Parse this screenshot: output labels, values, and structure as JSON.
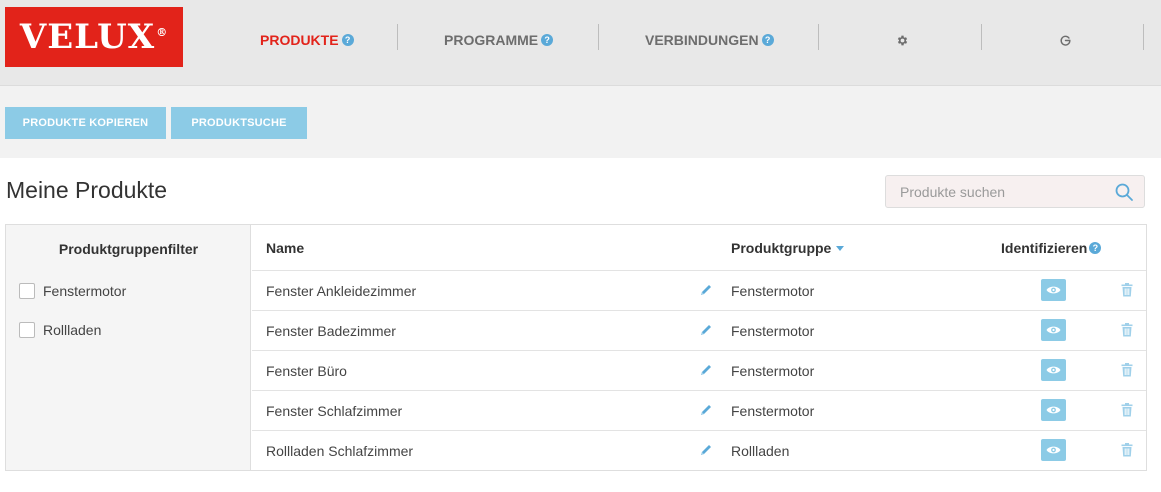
{
  "brand": {
    "logo_text": "VELUX",
    "logo_mark": "®",
    "color": "#e2231a"
  },
  "nav": {
    "items": [
      {
        "label": "PRODUKTE",
        "active": true
      },
      {
        "label": "PROGRAMME",
        "active": false
      },
      {
        "label": "VERBINDUNGEN",
        "active": false
      }
    ],
    "help_glyph": "?",
    "icons": [
      "gear-icon",
      "logout-icon"
    ]
  },
  "toolbar": {
    "copy_label": "PRODUKTE KOPIEREN",
    "search_label": "PRODUKTSUCHE"
  },
  "page": {
    "title": "Meine Produkte"
  },
  "search": {
    "placeholder": "Produkte suchen",
    "value": ""
  },
  "filter": {
    "title": "Produktgruppenfilter",
    "options": [
      {
        "label": "Fenstermotor",
        "checked": false
      },
      {
        "label": "Rollladen",
        "checked": false
      }
    ]
  },
  "table": {
    "columns": {
      "name": "Name",
      "group": "Produktgruppe",
      "identify": "Identifizieren"
    },
    "rows": [
      {
        "name": "Fenster Ankleidezimmer",
        "group": "Fenstermotor"
      },
      {
        "name": "Fenster Badezimmer",
        "group": "Fenstermotor"
      },
      {
        "name": "Fenster Büro",
        "group": "Fenstermotor"
      },
      {
        "name": "Fenster Schlafzimmer",
        "group": "Fenstermotor"
      },
      {
        "name": "Rollladen Schlafzimmer",
        "group": "Rollladen"
      }
    ]
  },
  "colors": {
    "accent": "#8ccbe6",
    "help": "#5aa9d8",
    "active_nav": "#e2231a"
  }
}
